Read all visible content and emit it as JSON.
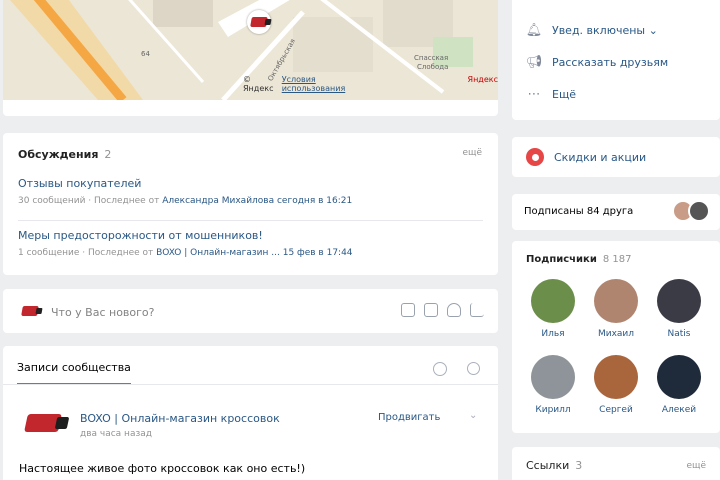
{
  "map": {
    "credits": [
      "© Яндекс",
      "Условия использования",
      "Яндекс"
    ],
    "labels": [
      "64",
      "Спасская",
      "Слобода",
      "Октябрьская"
    ]
  },
  "discussions": {
    "title": "Обсуждения",
    "count": "2",
    "all": "ещё",
    "topics": [
      {
        "title": "Отзывы покупателей",
        "count": "30 сообщений",
        "last_prefix": "Последнее от",
        "last_author": "Александра Михайлова сегодня в 16:21"
      },
      {
        "title": "Меры предосторожности от мошенников!",
        "count": "1 сообщение",
        "last_prefix": "Последнее от",
        "last_author": "BOXO | Онлайн-магазин ... 15 фев в 17:44"
      }
    ]
  },
  "composer": {
    "placeholder": "Что у Вас нового?",
    "tools": [
      "camera-icon",
      "video-icon",
      "music-icon",
      "text-icon"
    ]
  },
  "wall": {
    "tab": "Записи сообщества",
    "post": {
      "author": "BOXO | Онлайн-магазин кроссовок",
      "time": "два часа назад",
      "follow": "Продвигать",
      "text": "Настоящее живое фото кроссовок как оно есть!)"
    }
  },
  "actions": [
    {
      "icon": "bell-icon",
      "label": "Увед. включены ⌄"
    },
    {
      "icon": "megaphone-icon",
      "label": "Рассказать друзьям"
    },
    {
      "icon": "more-icon",
      "label": "Ещё"
    }
  ],
  "sales": {
    "label": "Скидки и акции"
  },
  "friends": {
    "label": "Подписаны 84 друга"
  },
  "members": {
    "title": "Подписчики",
    "count": "8 187",
    "people": [
      {
        "name": "Илья",
        "color": "#6b8f4a"
      },
      {
        "name": "Михаил",
        "color": "#b08570"
      },
      {
        "name": "Natis",
        "color": "#3b3b45"
      },
      {
        "name": "Кирилл",
        "color": "#8e9499"
      },
      {
        "name": "Сергей",
        "color": "#a9653c"
      },
      {
        "name": "Алекей",
        "color": "#1f2a3a"
      }
    ]
  },
  "links": {
    "title": "Ссылки",
    "count": "3",
    "all": "ещё"
  }
}
